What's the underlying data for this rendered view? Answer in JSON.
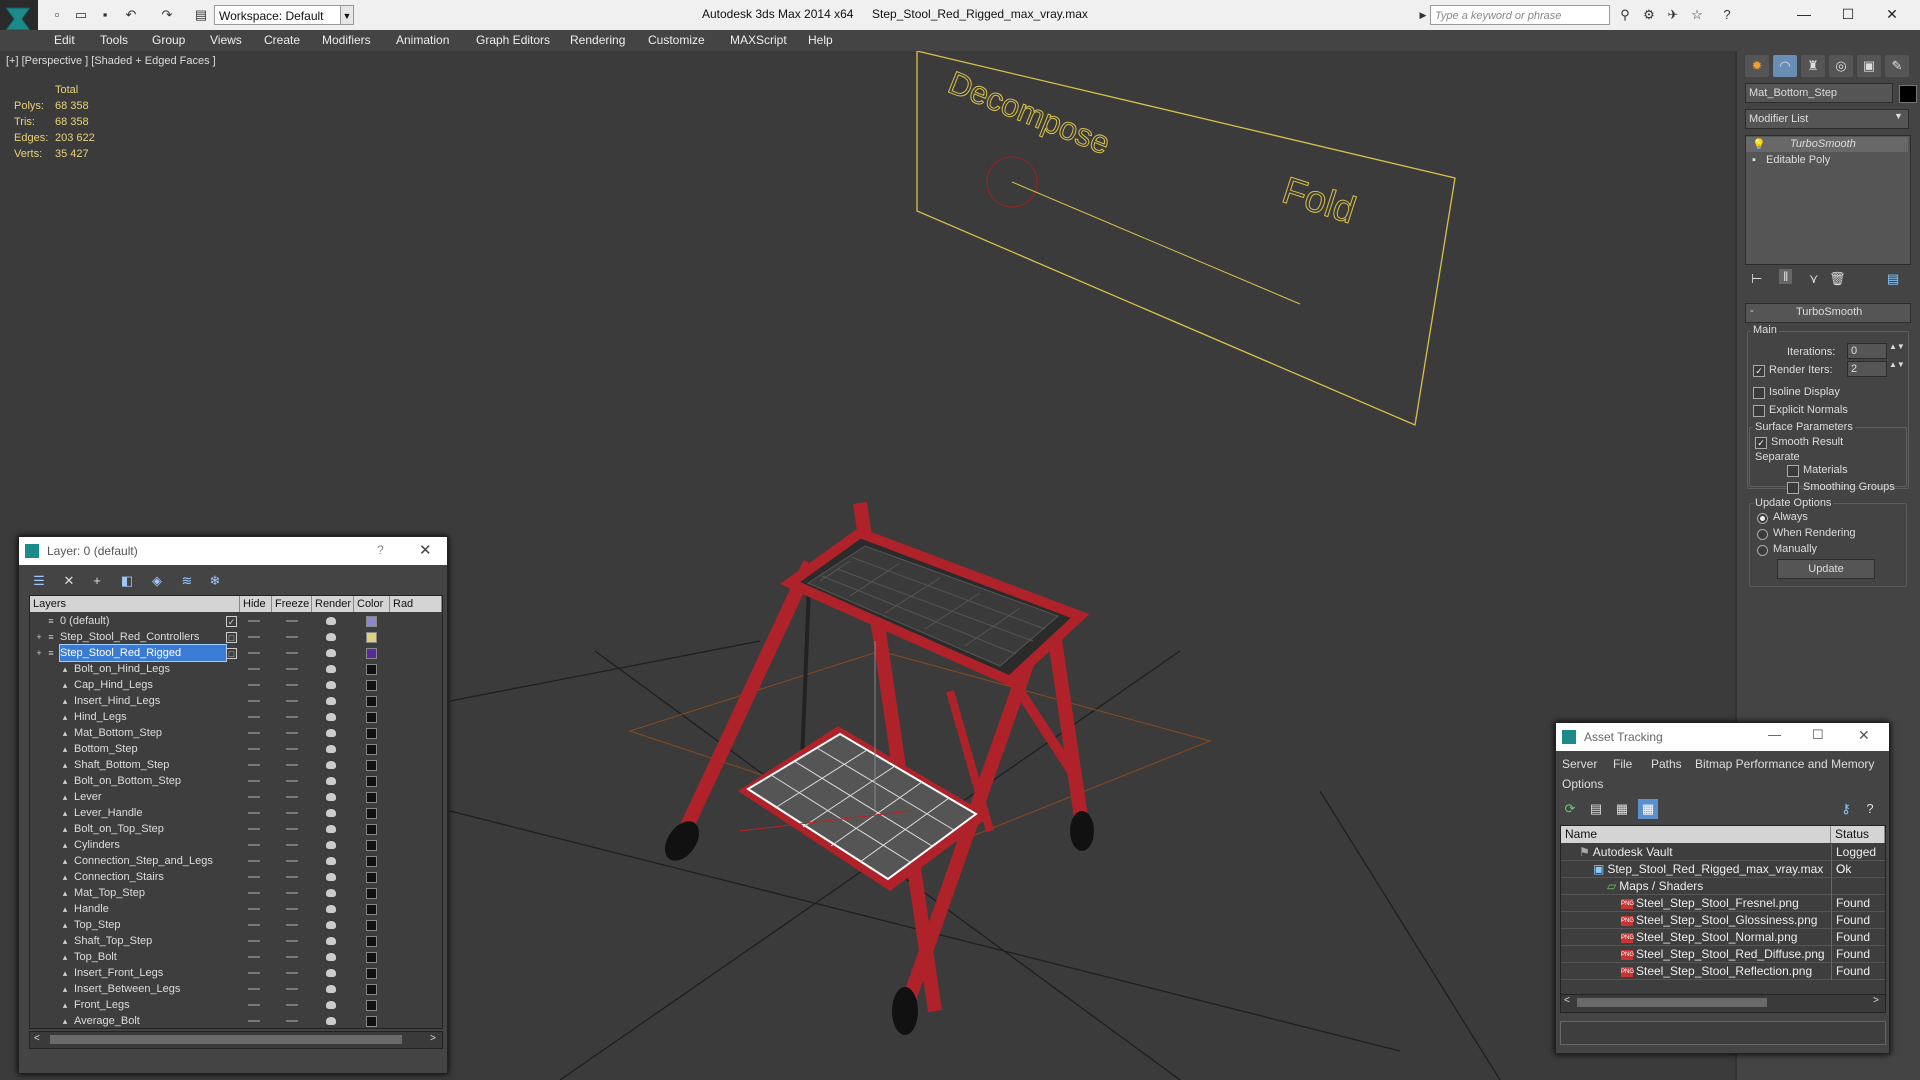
{
  "app": {
    "title": "Autodesk 3ds Max  2014 x64",
    "file": "Step_Stool_Red_Rigged_max_vray.max",
    "workspace": "Workspace: Default",
    "search_placeholder": "Type a keyword or phrase"
  },
  "menu": [
    "Edit",
    "Tools",
    "Group",
    "Views",
    "Create",
    "Modifiers",
    "Animation",
    "Graph Editors",
    "Rendering",
    "Customize",
    "MAXScript",
    "Help"
  ],
  "viewport": {
    "label": "[+] [Perspective ] [Shaded + Edged Faces ]",
    "stats_header": "Total",
    "stats": [
      {
        "label": "Polys:",
        "value": "68 358"
      },
      {
        "label": "Tris:",
        "value": "68 358"
      },
      {
        "label": "Edges:",
        "value": "203 622"
      },
      {
        "label": "Verts:",
        "value": "35 427"
      }
    ],
    "controller_labels": {
      "decompose": "Decompose",
      "fold": "Fold"
    },
    "colors": {
      "background": "#3b3b3b",
      "stool": "#b0222a",
      "controller": "#d8c04a",
      "grid": "#1f1f1f"
    }
  },
  "command_panel": {
    "object_name": "Mat_Bottom_Step",
    "modifier_list": "Modifier List",
    "stack": [
      "TurboSmooth",
      "Editable Poly"
    ],
    "rollout_title": "TurboSmooth",
    "main_label": "Main",
    "iterations_label": "Iterations:",
    "iterations_value": "0",
    "render_iters_label": "Render Iters:",
    "render_iters_value": "2",
    "render_iters_checked": true,
    "isoline_label": "Isoline Display",
    "explicit_normals_label": "Explicit Normals",
    "surface_params_label": "Surface Parameters",
    "smooth_result_label": "Smooth Result",
    "separate_label": "Separate",
    "materials_label": "Materials",
    "smoothing_groups_label": "Smoothing Groups",
    "update_options_label": "Update Options",
    "always_label": "Always",
    "when_rendering_label": "When Rendering",
    "manually_label": "Manually",
    "update_button": "Update"
  },
  "layer_dialog": {
    "title": "Layer: 0 (default)",
    "help": "?",
    "columns": [
      "Layers",
      "Hide",
      "Freeze",
      "Render",
      "Color",
      "Rad"
    ],
    "rows": [
      {
        "name": "0 (default)",
        "level": 0,
        "check": "✓",
        "color": "#8888cc",
        "selected": false
      },
      {
        "name": "Step_Stool_Red_Controllers",
        "level": 0,
        "check": "□",
        "color": "#e0d080",
        "selected": false
      },
      {
        "name": "Step_Stool_Red_Rigged",
        "level": 0,
        "check": "□",
        "color": "#5a2a9a",
        "selected": true
      },
      {
        "name": "Bolt_on_Hind_Legs",
        "level": 1,
        "color": "#111111"
      },
      {
        "name": "Cap_Hind_Legs",
        "level": 1,
        "color": "#111111"
      },
      {
        "name": "Insert_Hind_Legs",
        "level": 1,
        "color": "#111111"
      },
      {
        "name": "Hind_Legs",
        "level": 1,
        "color": "#111111"
      },
      {
        "name": "Mat_Bottom_Step",
        "level": 1,
        "color": "#111111"
      },
      {
        "name": "Bottom_Step",
        "level": 1,
        "color": "#111111"
      },
      {
        "name": "Shaft_Bottom_Step",
        "level": 1,
        "color": "#111111"
      },
      {
        "name": "Bolt_on_Bottom_Step",
        "level": 1,
        "color": "#111111"
      },
      {
        "name": "Lever",
        "level": 1,
        "color": "#111111"
      },
      {
        "name": "Lever_Handle",
        "level": 1,
        "color": "#111111"
      },
      {
        "name": "Bolt_on_Top_Step",
        "level": 1,
        "color": "#111111"
      },
      {
        "name": "Cylinders",
        "level": 1,
        "color": "#111111"
      },
      {
        "name": "Connection_Step_and_Legs",
        "level": 1,
        "color": "#111111"
      },
      {
        "name": "Connection_Stairs",
        "level": 1,
        "color": "#111111"
      },
      {
        "name": "Mat_Top_Step",
        "level": 1,
        "color": "#111111"
      },
      {
        "name": "Handle",
        "level": 1,
        "color": "#111111"
      },
      {
        "name": "Top_Step",
        "level": 1,
        "color": "#111111"
      },
      {
        "name": "Shaft_Top_Step",
        "level": 1,
        "color": "#111111"
      },
      {
        "name": "Top_Bolt",
        "level": 1,
        "color": "#111111"
      },
      {
        "name": "Insert_Front_Legs",
        "level": 1,
        "color": "#111111"
      },
      {
        "name": "Insert_Between_Legs",
        "level": 1,
        "color": "#111111"
      },
      {
        "name": "Front_Legs",
        "level": 1,
        "color": "#111111"
      },
      {
        "name": "Average_Bolt",
        "level": 1,
        "color": "#111111"
      }
    ]
  },
  "asset_tracking": {
    "title": "Asset Tracking",
    "menu": [
      "Server",
      "File",
      "Paths",
      "Bitmap Performance and Memory"
    ],
    "menu2": "Options",
    "columns": [
      "Name",
      "Status"
    ],
    "rows": [
      {
        "name": "Autodesk Vault",
        "status": "Logged O",
        "indent": 0,
        "type": "vault"
      },
      {
        "name": "Step_Stool_Red_Rigged_max_vray.max",
        "status": "Ok",
        "indent": 1,
        "type": "max"
      },
      {
        "name": "Maps / Shaders",
        "status": "",
        "indent": 2,
        "type": "folder"
      },
      {
        "name": "Steel_Step_Stool_Fresnel.png",
        "status": "Found",
        "indent": 3,
        "type": "png"
      },
      {
        "name": "Steel_Step_Stool_Glossiness.png",
        "status": "Found",
        "indent": 3,
        "type": "png"
      },
      {
        "name": "Steel_Step_Stool_Normal.png",
        "status": "Found",
        "indent": 3,
        "type": "png"
      },
      {
        "name": "Steel_Step_Stool_Red_Diffuse.png",
        "status": "Found",
        "indent": 3,
        "type": "png"
      },
      {
        "name": "Steel_Step_Stool_Reflection.png",
        "status": "Found",
        "indent": 3,
        "type": "png"
      }
    ]
  }
}
